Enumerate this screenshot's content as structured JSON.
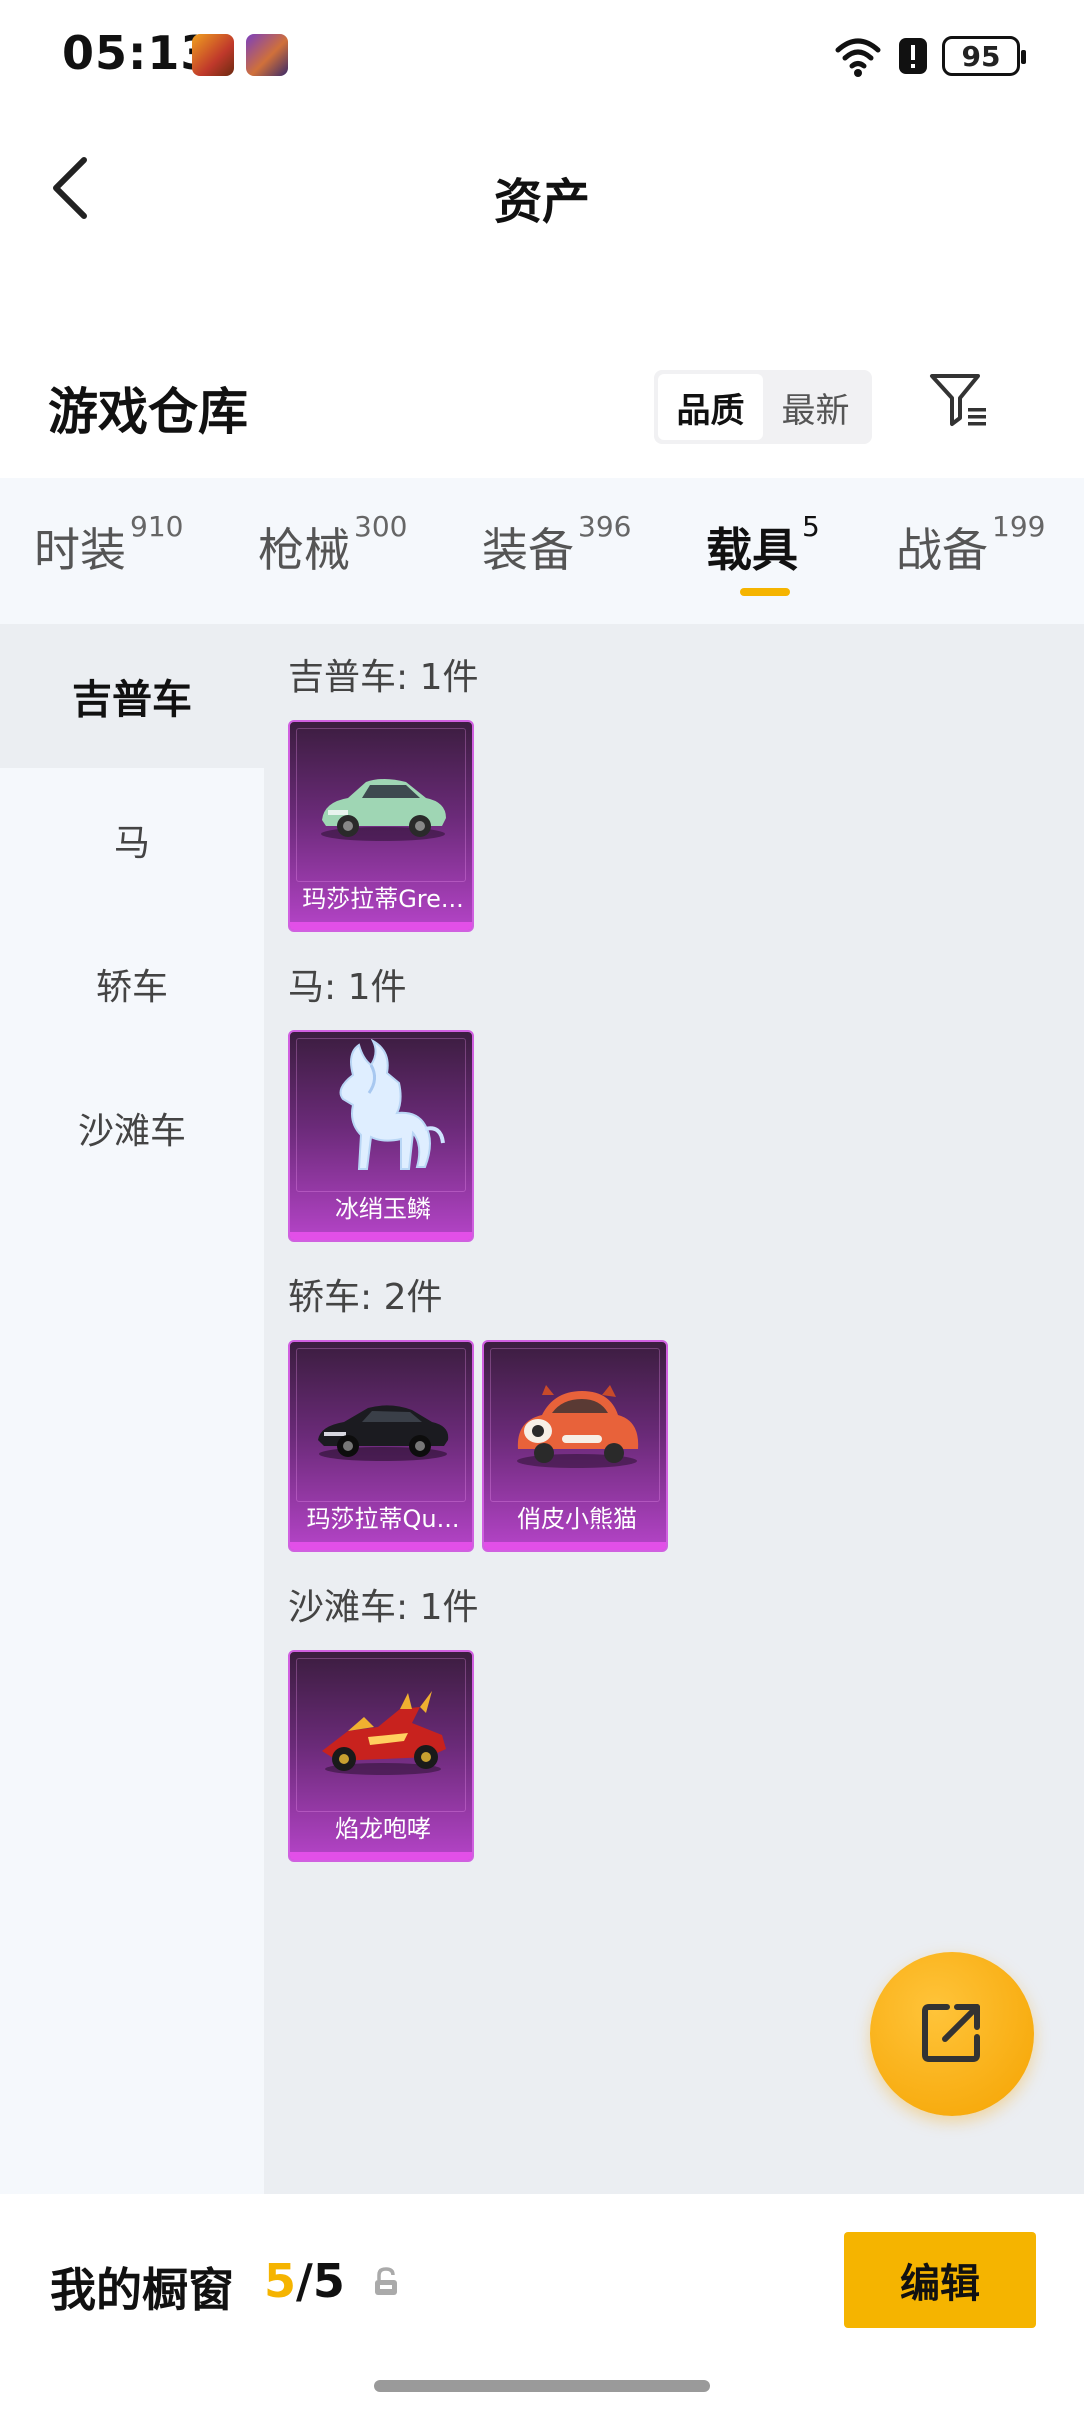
{
  "status_bar": {
    "time": "05:13",
    "battery": "95",
    "icons": [
      "app-icon-game-1",
      "app-icon-game-2",
      "wifi-icon",
      "alert-icon",
      "battery-icon"
    ]
  },
  "header": {
    "title": "资产",
    "back_icon": "chevron-left-icon"
  },
  "warehouse": {
    "title": "游戏仓库",
    "sort_options": [
      {
        "label": "品质",
        "active": true
      },
      {
        "label": "最新",
        "active": false
      }
    ],
    "filter_icon": "filter-icon"
  },
  "tabs": [
    {
      "label": "时装",
      "count": "910",
      "active": false
    },
    {
      "label": "枪械",
      "count": "300",
      "active": false
    },
    {
      "label": "装备",
      "count": "396",
      "active": false
    },
    {
      "label": "载具",
      "count": "5",
      "active": true
    },
    {
      "label": "战备",
      "count": "199",
      "active": false
    }
  ],
  "sidebar": {
    "items": [
      {
        "label": "吉普车",
        "active": true
      },
      {
        "label": "马",
        "active": false
      },
      {
        "label": "轿车",
        "active": false
      },
      {
        "label": "沙滩车",
        "active": false
      }
    ]
  },
  "groups": [
    {
      "title": "吉普车: 1件",
      "items": [
        {
          "name": "玛莎拉蒂Gre...",
          "image": "green-suv"
        }
      ]
    },
    {
      "title": "马: 1件",
      "items": [
        {
          "name": "冰绡玉鳞",
          "image": "ice-horse"
        }
      ]
    },
    {
      "title": "轿车: 2件",
      "items": [
        {
          "name": "玛莎拉蒂Qu...",
          "image": "black-sedan"
        },
        {
          "name": "俏皮小熊猫",
          "image": "red-panda-car"
        }
      ]
    },
    {
      "title": "沙滩车: 1件",
      "items": [
        {
          "name": "焰龙咆哮",
          "image": "red-dragon-buggy"
        }
      ]
    }
  ],
  "fab": {
    "icon": "share-icon"
  },
  "showcase": {
    "label": "我的橱窗",
    "current": "5",
    "separator": "/",
    "total": "5",
    "lock_icon": "lock-icon",
    "edit_label": "编辑"
  },
  "colors": {
    "accent": "#f5b400",
    "card_purple": "#b544c8",
    "panel_bg": "#ebeef2",
    "sidebar_bg": "#f5f8fc"
  }
}
